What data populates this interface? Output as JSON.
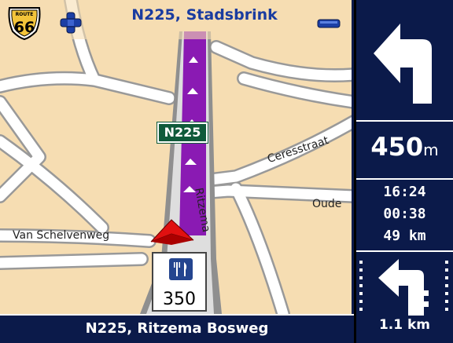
{
  "header": {
    "street": "N225, Stadsbrink",
    "route_badge": "66",
    "route_badge_top": "ROUTE"
  },
  "map": {
    "road_shield": "N225",
    "labels": {
      "ceresstraat": "Ceresstraat",
      "oude": "Oude",
      "van_schelvenweg": "Van Schelvenweg",
      "ritzema": "Ritzema"
    },
    "poi": {
      "icon": "restaurant-icon",
      "distance": "350"
    }
  },
  "footer": {
    "street": "N225, Ritzema Bosweg"
  },
  "panel": {
    "turn_icon": "turn-left-arrow-icon",
    "distance_value": "450",
    "distance_unit": "m",
    "time": "16:24",
    "duration": "00:38",
    "remaining": "49 km",
    "next_turn_icon": "next-turn-left-icon",
    "next_distance": "1.1 km"
  },
  "colors": {
    "map_bg": "#f6ddb2",
    "route": "#8a1ab3",
    "panel_bg": "#0b1a4a",
    "street_text": "#1a3ca0",
    "shield_bg": "#0f5a3a"
  }
}
